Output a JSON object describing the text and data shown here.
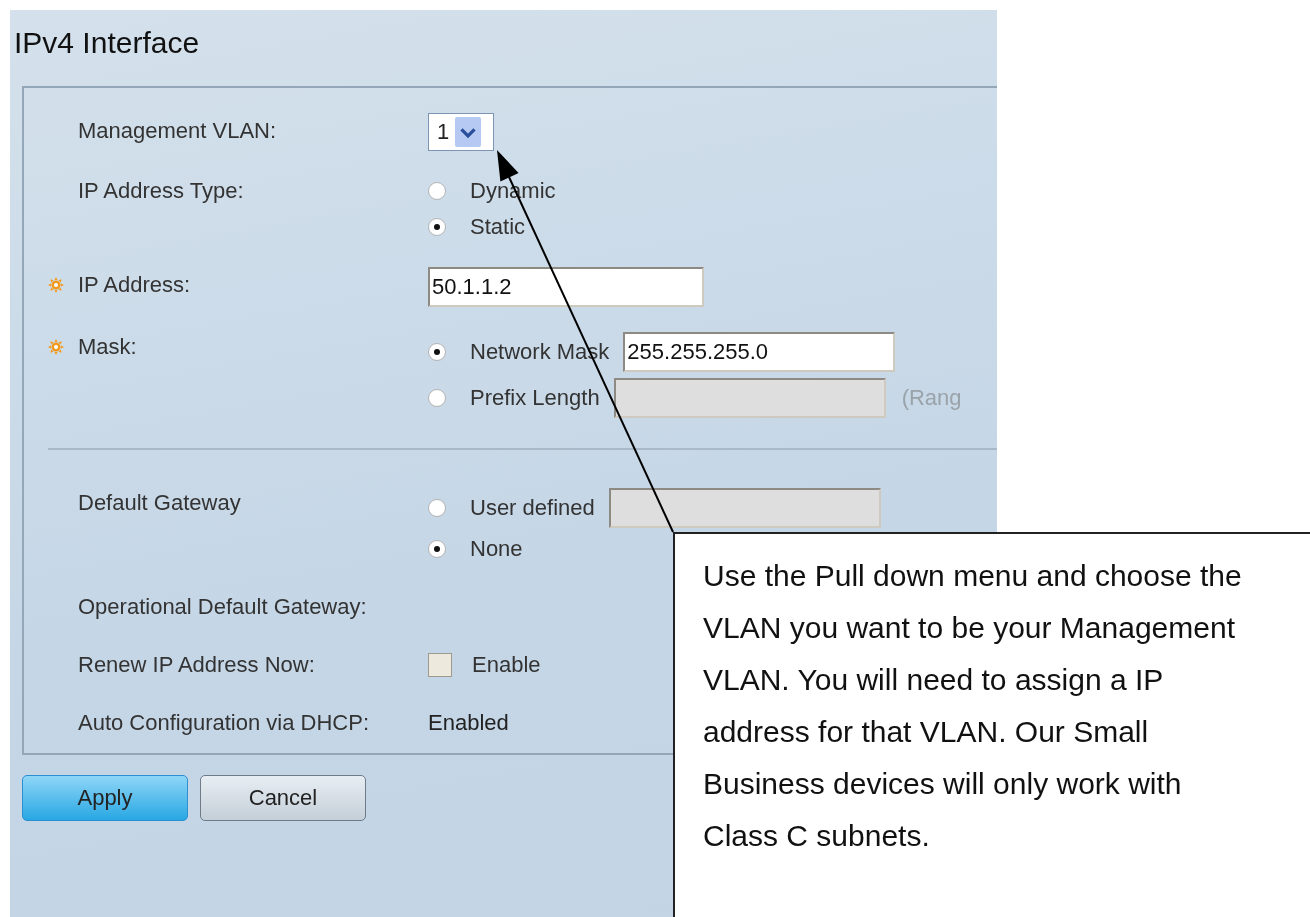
{
  "title": "IPv4 Interface",
  "sections": [
    [
      {
        "kind": "select",
        "label": "Management VLAN:",
        "value": "1"
      },
      {
        "kind": "radio",
        "label": "IP Address Type:",
        "options": [
          {
            "label": "Dynamic",
            "selected": false
          },
          {
            "label": "Static",
            "selected": true
          }
        ]
      },
      {
        "kind": "input",
        "label": "IP Address:",
        "required": true,
        "value": "50.1.1.2"
      },
      {
        "kind": "radio",
        "label": "Mask:",
        "required": true,
        "options": [
          {
            "label": "Network Mask",
            "selected": true,
            "field": {
              "value": "255.255.255.0",
              "disabled": false
            }
          },
          {
            "label": "Prefix Length",
            "selected": false,
            "field": {
              "disabled": true
            },
            "note": "(Rang"
          }
        ]
      }
    ],
    [
      {
        "kind": "radio",
        "label": "Default Gateway",
        "options": [
          {
            "label": "User defined",
            "selected": false,
            "field": {
              "disabled": true
            }
          },
          {
            "label": "None",
            "selected": true
          }
        ]
      },
      {
        "kind": "text",
        "label": "Operational Default Gateway:"
      },
      {
        "kind": "checkbox",
        "label": "Renew IP Address Now:",
        "option": "Enable",
        "checked": false
      },
      {
        "kind": "text",
        "label": "Auto Configuration via DHCP:",
        "value": "Enabled"
      }
    ]
  ],
  "buttons": [
    {
      "label": "Apply",
      "primary": true
    },
    {
      "label": "Cancel",
      "primary": false
    }
  ],
  "callout": {
    "text": "Use the Pull down menu and choose the VLAN you want to be your Management VLAN. You will need to assign a IP address for that VLAN. Our Small Business devices will only work with Class C subnets."
  }
}
